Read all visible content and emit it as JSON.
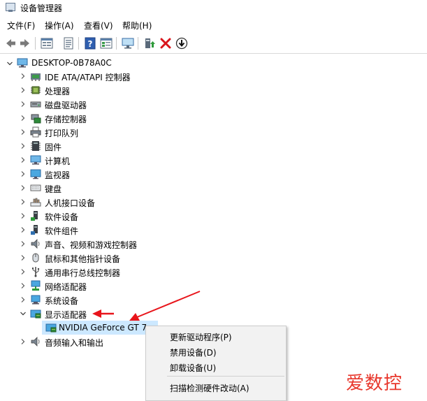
{
  "window": {
    "title": "设备管理器"
  },
  "menu": [
    "文件(F)",
    "操作(A)",
    "查看(V)",
    "帮助(H)"
  ],
  "toolbar_icons": [
    "back-arrow-icon",
    "forward-arrow-icon",
    "properties-icon",
    "show-hidden-icon",
    "help-icon",
    "view-icon",
    "monitor-icon",
    "enable-device-icon",
    "uninstall-icon",
    "update-driver-icon"
  ],
  "tree": {
    "root": "DESKTOP-0B78A0C",
    "items": [
      {
        "label": "IDE ATA/ATAPI 控制器",
        "icon": "ide-controller-icon"
      },
      {
        "label": "处理器",
        "icon": "processor-icon"
      },
      {
        "label": "磁盘驱动器",
        "icon": "disk-drive-icon"
      },
      {
        "label": "存储控制器",
        "icon": "storage-controller-icon"
      },
      {
        "label": "打印队列",
        "icon": "printer-icon"
      },
      {
        "label": "固件",
        "icon": "firmware-icon"
      },
      {
        "label": "计算机",
        "icon": "computer-icon"
      },
      {
        "label": "监视器",
        "icon": "monitor-icon"
      },
      {
        "label": "键盘",
        "icon": "keyboard-icon"
      },
      {
        "label": "人机接口设备",
        "icon": "hid-icon"
      },
      {
        "label": "软件设备",
        "icon": "software-device-icon"
      },
      {
        "label": "软件组件",
        "icon": "software-component-icon"
      },
      {
        "label": "声音、视频和游戏控制器",
        "icon": "speaker-icon"
      },
      {
        "label": "鼠标和其他指针设备",
        "icon": "mouse-icon"
      },
      {
        "label": "通用串行总线控制器",
        "icon": "usb-icon"
      },
      {
        "label": "网络适配器",
        "icon": "network-adapter-icon"
      },
      {
        "label": "系统设备",
        "icon": "system-device-icon"
      },
      {
        "label": "显示适配器",
        "icon": "display-adapter-icon",
        "expanded": true
      },
      {
        "label": "NVIDIA GeForce GT 7",
        "icon": "display-adapter-icon",
        "child": true,
        "selected": true
      },
      {
        "label": "音频输入和输出",
        "icon": "speaker-icon"
      }
    ]
  },
  "context_menu": {
    "items": [
      "更新驱动程序(P)",
      "禁用设备(D)",
      "卸载设备(U)",
      "扫描检测硬件改动(A)"
    ]
  },
  "watermark": "爱数控",
  "colors": {
    "arrow": "#e8151b",
    "selection": "#cce8ff",
    "watermark": "#e8372c"
  }
}
